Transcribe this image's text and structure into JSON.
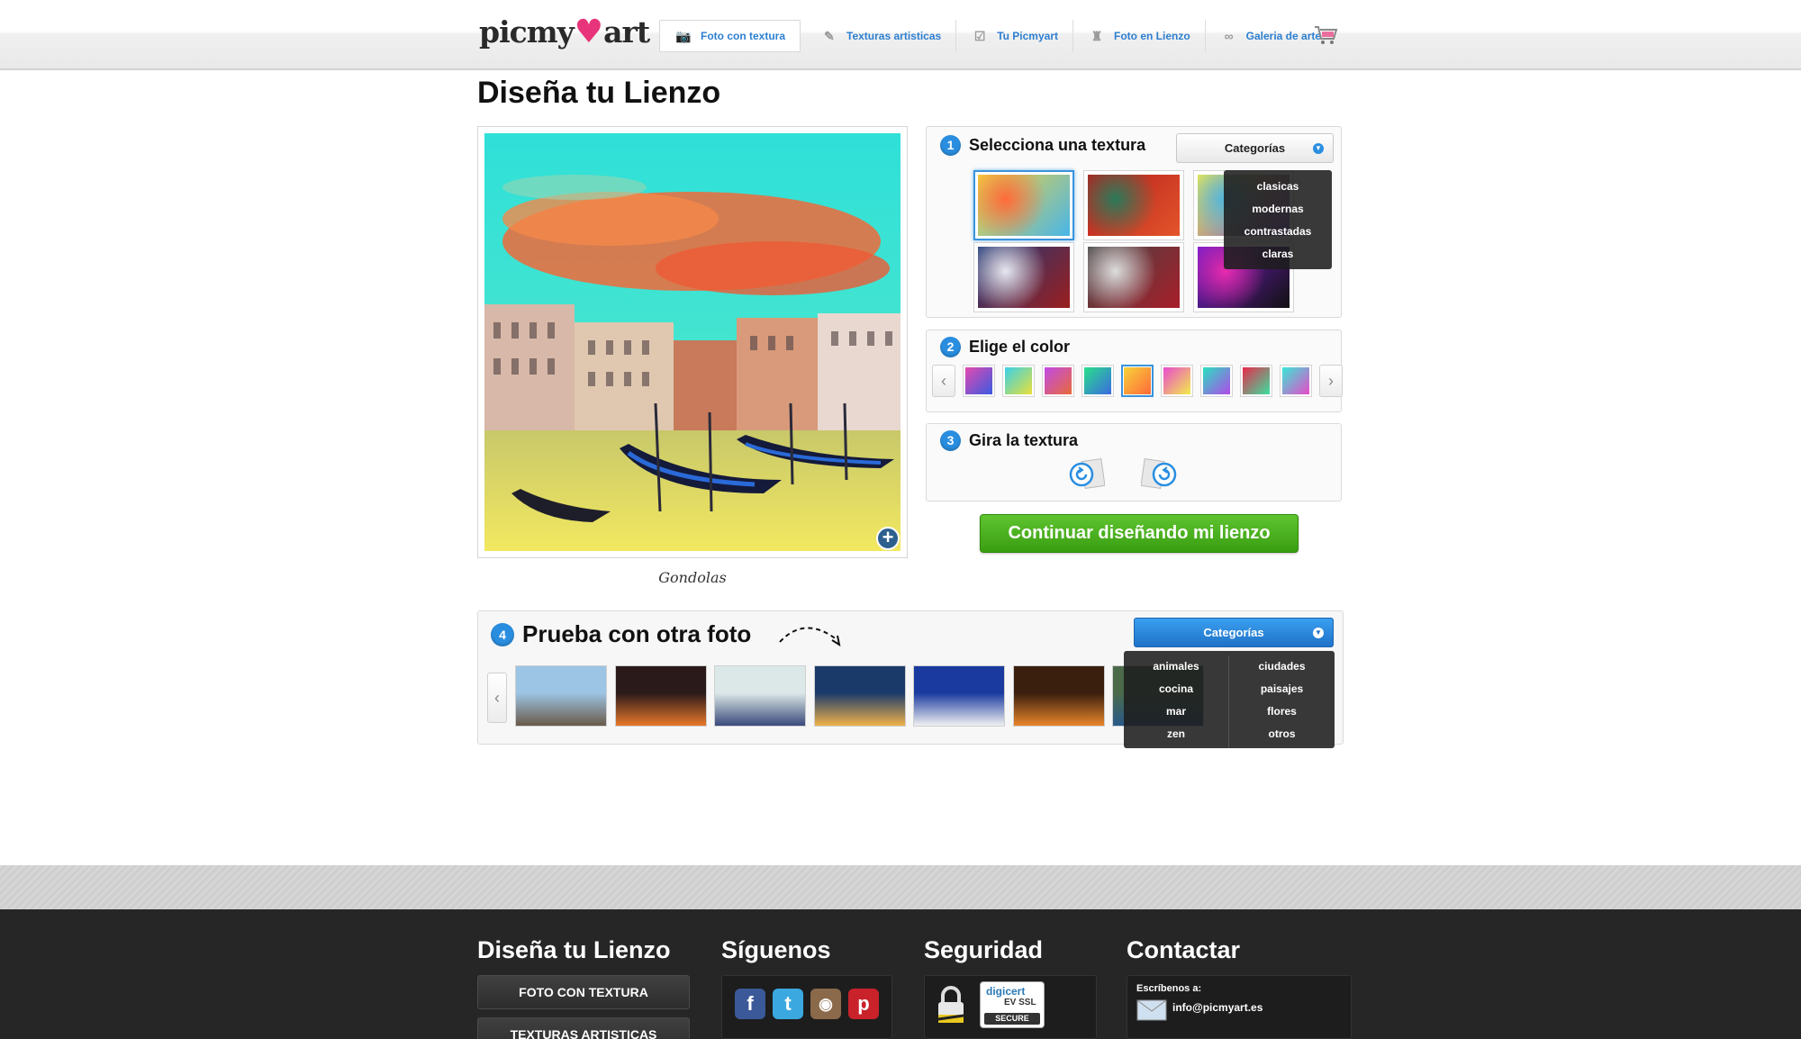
{
  "header": {
    "logo_left": "picmy",
    "logo_heart": "♥",
    "logo_right": "art",
    "nav": [
      {
        "label": "Foto con textura",
        "icon": "camera-icon",
        "glyph": "📷"
      },
      {
        "label": "Texturas artisticas",
        "icon": "brush-icon",
        "glyph": "✎"
      },
      {
        "label": "Tu Picmyart",
        "icon": "checkbox-icon",
        "glyph": "☑"
      },
      {
        "label": "Foto en Lienzo",
        "icon": "easel-icon",
        "glyph": "♜"
      },
      {
        "label": "Galeria de arte",
        "icon": "glasses-icon",
        "glyph": "∞"
      }
    ],
    "cart_icon": "shopping-cart-icon"
  },
  "page_title": "Diseña tu Lienzo",
  "preview": {
    "caption": "Gondolas",
    "zoom_icon": "plus-icon"
  },
  "step1": {
    "num": "1",
    "title": "Selecciona una textura",
    "category_button": "Categorías",
    "dropdown_options": [
      "clasicas",
      "modernas",
      "contrastadas",
      "claras"
    ],
    "textures": [
      {
        "colors": [
          "#f6d33a",
          "#ff6a3a",
          "#48b6e8"
        ],
        "selected": true
      },
      {
        "colors": [
          "#b51e1e",
          "#2a7a5a",
          "#e3552a"
        ],
        "selected": false
      },
      {
        "colors": [
          "#f3ec4a",
          "#4fb6e0",
          "#7a4ad0"
        ],
        "selected": false
      },
      {
        "colors": [
          "#1e3a7a",
          "#e8e8f0",
          "#9a1e1e"
        ],
        "selected": false
      },
      {
        "colors": [
          "#444",
          "#ddd",
          "#a81e2a"
        ],
        "selected": false
      },
      {
        "colors": [
          "#7a1ed0",
          "#e82ab0",
          "#111"
        ],
        "selected": false
      }
    ]
  },
  "step2": {
    "num": "2",
    "title": "Elige el color",
    "prev_icon": "chevron-left-icon",
    "next_icon": "chevron-right-icon",
    "swatches": [
      {
        "colors": [
          "#e44ab0",
          "#3a5ae0"
        ],
        "selected": false
      },
      {
        "colors": [
          "#3ad0e8",
          "#e8e03a"
        ],
        "selected": false
      },
      {
        "colors": [
          "#c04ae8",
          "#e86a3a"
        ],
        "selected": false
      },
      {
        "colors": [
          "#2ae08a",
          "#3a6ae0"
        ],
        "selected": false
      },
      {
        "colors": [
          "#f6d33a",
          "#ff6a3a"
        ],
        "selected": true
      },
      {
        "colors": [
          "#e84ad0",
          "#f3ec4a"
        ],
        "selected": false
      },
      {
        "colors": [
          "#2ae0c0",
          "#b04ae8"
        ],
        "selected": false
      },
      {
        "colors": [
          "#e82a4a",
          "#3ae0a0"
        ],
        "selected": false
      },
      {
        "colors": [
          "#3ae8d8",
          "#e84ac8"
        ],
        "selected": false
      }
    ]
  },
  "step3": {
    "num": "3",
    "title": "Gira la textura",
    "rotate_left_icon": "rotate-left-icon",
    "rotate_right_icon": "rotate-right-icon"
  },
  "continue_button": "Continuar diseñando mi lienzo",
  "step4": {
    "num": "4",
    "title": "Prueba con otra foto",
    "category_button": "Categorías",
    "dropdown_col1": [
      "animales",
      "cocina",
      "mar",
      "zen"
    ],
    "dropdown_col2": [
      "ciudades",
      "paisajes",
      "flores",
      "otros"
    ],
    "thumbs": [
      {
        "subject": "eiffel tower",
        "colors": [
          "#9cc4e4",
          "#6a5a4a"
        ]
      },
      {
        "subject": "night traffic",
        "colors": [
          "#2a1a1a",
          "#e8782a"
        ]
      },
      {
        "subject": "gondolas",
        "colors": [
          "#dce8e8",
          "#3a4a7a"
        ]
      },
      {
        "subject": "lit building",
        "colors": [
          "#1a3a6a",
          "#f0b24a"
        ]
      },
      {
        "subject": "santorini",
        "colors": [
          "#1a3aa0",
          "#f0f0f0"
        ]
      },
      {
        "subject": "sunset river",
        "colors": [
          "#3a1e0e",
          "#e8862a"
        ]
      },
      {
        "subject": "city",
        "colors": [
          "#4a6a4a",
          "#2a5a8a"
        ]
      }
    ]
  },
  "footer": {
    "col1_title": "Diseña tu Lienzo",
    "col1_buttons": [
      "FOTO CON TEXTURA",
      "TEXTURAS ARTISTICAS"
    ],
    "col2_title": "Síguenos",
    "social": [
      {
        "icon": "facebook-icon",
        "glyph": "f",
        "color": "#3b5998"
      },
      {
        "icon": "twitter-icon",
        "glyph": "t",
        "color": "#3ba9e0"
      },
      {
        "icon": "instagram-icon",
        "glyph": "◉",
        "color": "#8a6a4a"
      },
      {
        "icon": "pinterest-icon",
        "glyph": "p",
        "color": "#c9222a"
      }
    ],
    "col3_title": "Seguridad",
    "lock_icon": "padlock-icon",
    "ssl_badge": {
      "brand": "digicert",
      "line2": "EV SSL",
      "line3": "SECURE"
    },
    "col4_title": "Contactar",
    "contact_label": "Escríbenos a:",
    "contact_email": "info@picmyart.es",
    "mail_icon": "envelope-icon"
  }
}
